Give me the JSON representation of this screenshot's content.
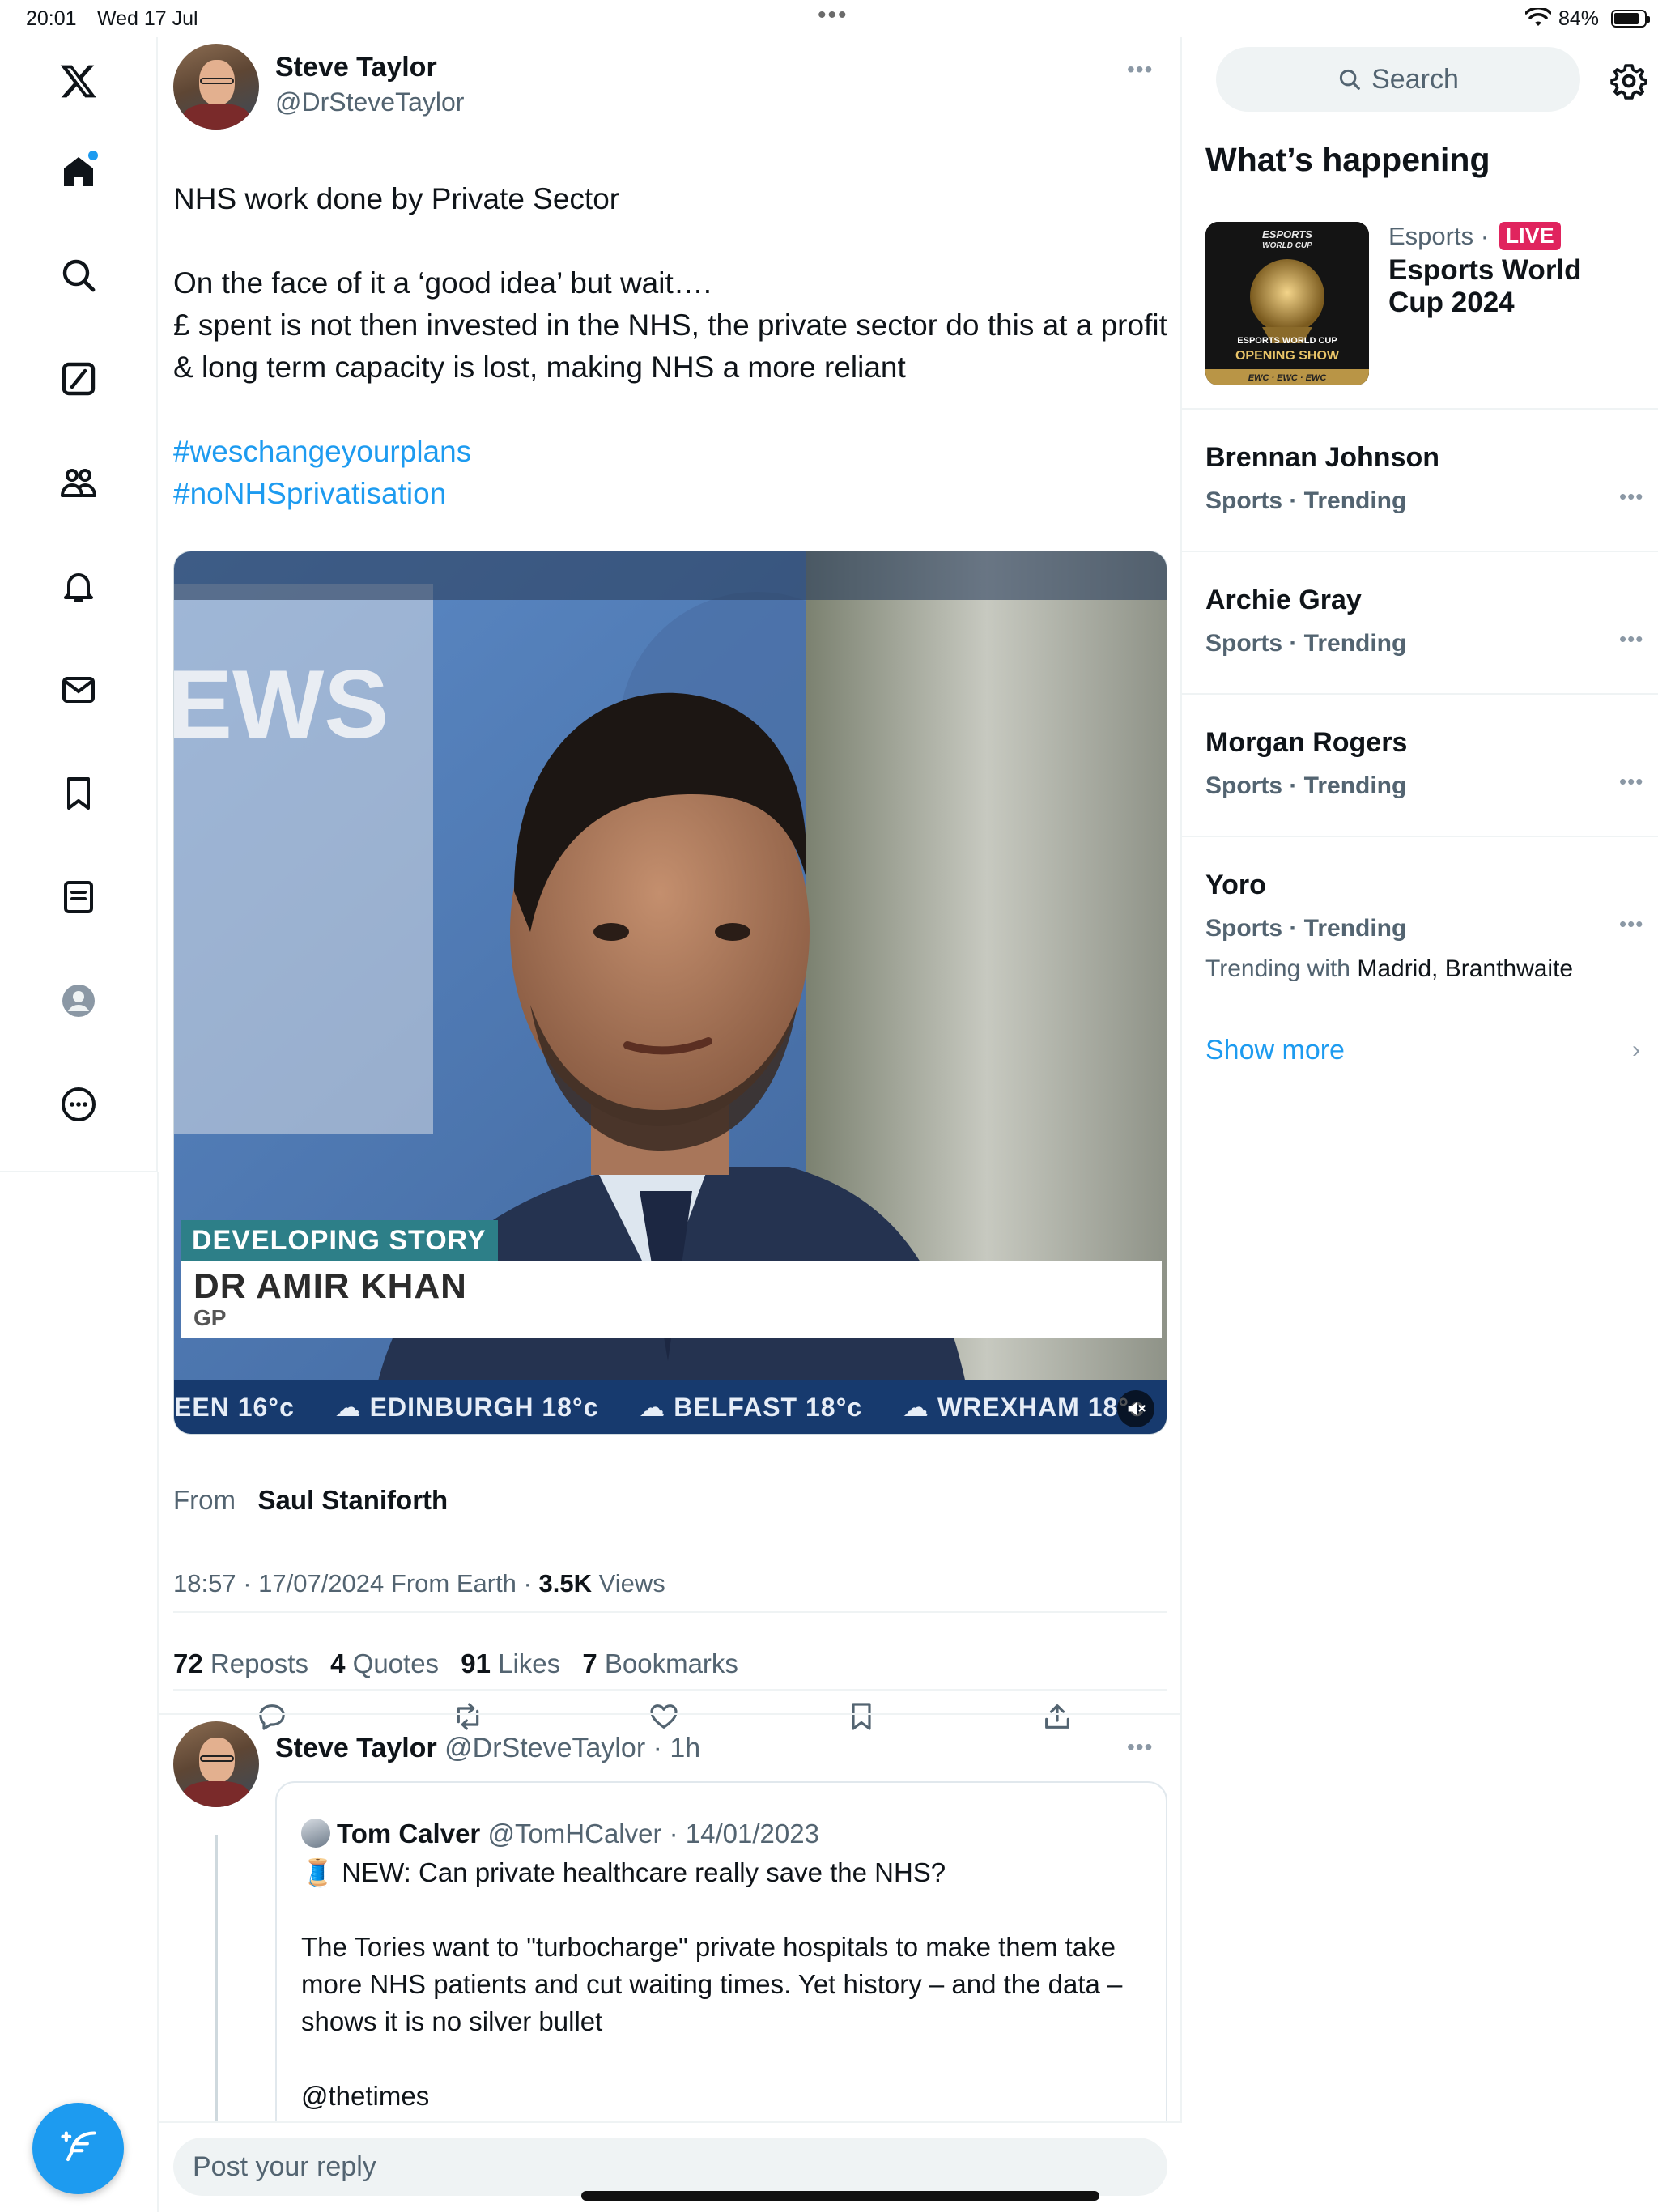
{
  "status_bar": {
    "time": "20:01",
    "date": "Wed 17 Jul",
    "battery_text": "84%",
    "battery_level": 0.84
  },
  "nav": {
    "items": [
      "x-logo",
      "home",
      "search",
      "grok",
      "communities",
      "notifications",
      "messages",
      "bookmarks",
      "lists",
      "profile",
      "more"
    ]
  },
  "post": {
    "author_name": "Steve Taylor",
    "author_handle": "@DrSteveTaylor",
    "line1": "NHS work done by Private Sector",
    "line2": "On the face of it a ‘good idea’ but wait….",
    "line3": "£ spent is not then invested in the NHS, the private sector do this at a profit & long term capacity is lost, making NHS a more reliant",
    "hashtag1": "#weschangeyourplans",
    "hashtag2": "#noNHSprivatisation",
    "video": {
      "tag": "DEVELOPING STORY",
      "name": "DR AMIR KHAN",
      "role": "GP",
      "bg_text": "EWS",
      "ticker": [
        "EEN 16°c",
        "EDINBURGH 18°c",
        "BELFAST 18°c",
        "WREXHAM 18°c"
      ]
    },
    "from_label": "From",
    "from_name": "Saul Staniforth",
    "time_date": "18:57 · 17/07/2024 From Earth ·",
    "views_count": "3.5K",
    "views_label": "Views",
    "stats": {
      "reposts_count": "72",
      "reposts_label": "Reposts",
      "quotes_count": "4",
      "quotes_label": "Quotes",
      "likes_count": "91",
      "likes_label": "Likes",
      "bookmarks_count": "7",
      "bookmarks_label": "Bookmarks"
    }
  },
  "reply": {
    "author_name": "Steve Taylor",
    "author_meta": "@DrSteveTaylor · 1h",
    "quote": {
      "author_name": "Tom Calver",
      "author_meta": "@TomHCalver · 14/01/2023",
      "line1": "🧵 NEW: Can private healthcare really save the NHS?",
      "line2": "The Tories want to \"turbocharge\" private hospitals to make them take more NHS patients and cut waiting times. Yet history – and the data – shows it is no silver bullet",
      "line3": "@thetimes"
    }
  },
  "reply_input": {
    "placeholder": "Post your reply"
  },
  "sidebar": {
    "search_placeholder": "Search",
    "title": "What’s happening",
    "featured": {
      "category": "Esports",
      "live": "LIVE",
      "title": "Esports World Cup 2024",
      "thumb_text1": "ESPORTS WORLD CUP",
      "thumb_text2": "OPENING SHOW"
    },
    "trends": [
      {
        "name": "Brennan Johnson",
        "meta": "Sports · Trending"
      },
      {
        "name": "Archie Gray",
        "meta": "Sports · Trending"
      },
      {
        "name": "Morgan Rogers",
        "meta": "Sports · Trending"
      },
      {
        "name": "Yoro",
        "meta": "Sports · Trending",
        "with_label": "Trending with",
        "with_value": "Madrid, Branthwaite"
      }
    ],
    "show_more": "Show more"
  },
  "colors": {
    "accent": "#1d9bf0",
    "live": "#e0245e",
    "text": "#0f1419",
    "muted": "#536471"
  }
}
